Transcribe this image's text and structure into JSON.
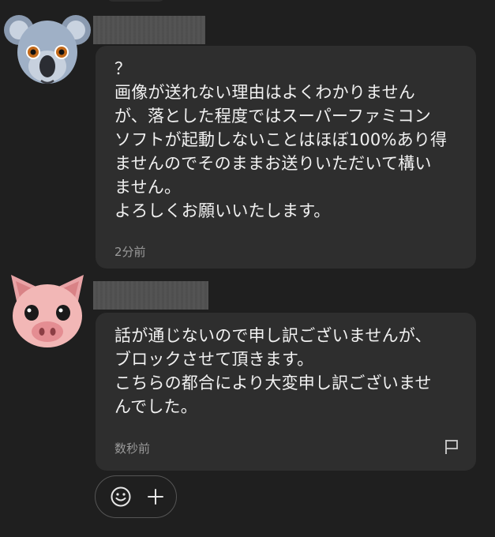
{
  "messages": [
    {
      "sender": "koala",
      "avatar_icon": "koala-avatar-icon",
      "text": "？\n画像が送れない理由はよくわかりません\nが、落とした程度ではスーパーファミコン\nソフトが起動しないことはほぼ100%あり得\nませんのでそのままお送りいただいて構い\nません。\nよろしくお願いいたします。",
      "time": "2分前"
    },
    {
      "sender": "pig",
      "avatar_icon": "pig-avatar-icon",
      "text": "話が通じないので申し訳ございませんが、\nブロックさせて頂きます。\nこちらの都合により大変申し訳ございませ\nんでした。",
      "time": "数秒前",
      "report_icon": "flag-icon"
    }
  ],
  "actions": {
    "emoji_icon": "smiley-icon",
    "add_icon": "plus-icon"
  },
  "colors": {
    "background": "#1f1f1f",
    "bubble": "#2e2e2e",
    "text": "#f1f1f1",
    "timestamp": "#9a9a9a"
  }
}
